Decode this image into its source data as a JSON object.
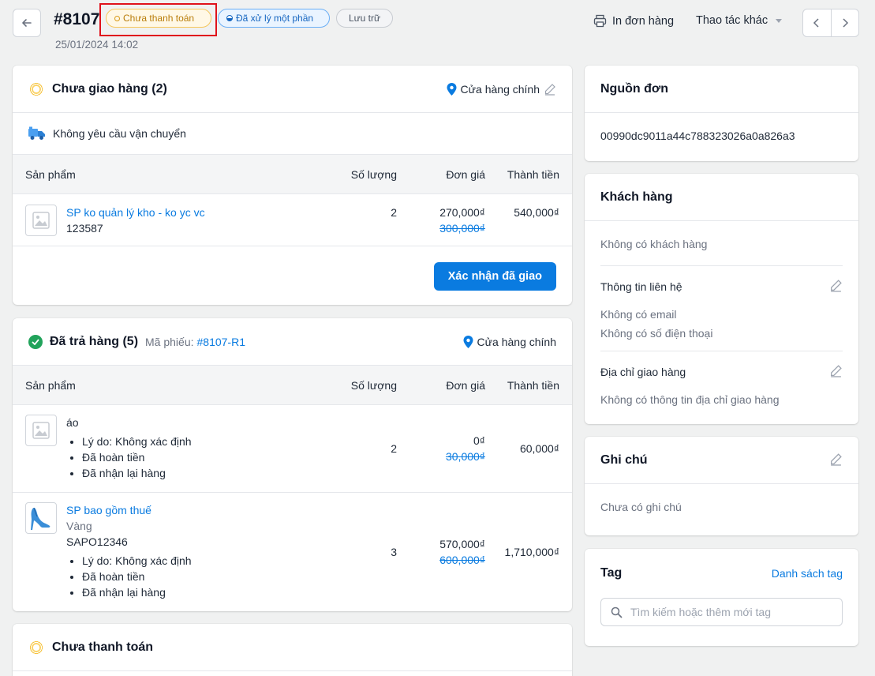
{
  "header": {
    "order_no": "#8107",
    "date": "25/01/2024 14:02",
    "badges": {
      "unpaid": "Chưa thanh toán",
      "partial": "Đã xử lý một phần",
      "archive": "Lưu trữ"
    },
    "print_label": "In đơn hàng",
    "more_label": "Thao tác khác"
  },
  "unfulfilled": {
    "title": "Chưa giao hàng (2)",
    "location": "Cửa hàng chính",
    "shipping_note": "Không yêu cầu vận chuyển",
    "columns": [
      "Sản phẩm",
      "Số lượng",
      "Đơn giá",
      "Thành tiền"
    ],
    "items": [
      {
        "name": "SP ko quản lý kho - ko yc vc",
        "sku": "123587",
        "qty": "2",
        "price": "270,000₫",
        "old_price": "300,000₫",
        "total": "540,000₫"
      }
    ],
    "confirm_button": "Xác nhận đã giao"
  },
  "returned": {
    "title": "Đã trả hàng (5)",
    "ticket_label": "Mã phiếu:",
    "ticket_no": "#8107-R1",
    "location": "Cửa hàng chính",
    "columns": [
      "Sản phẩm",
      "Số lượng",
      "Đơn giá",
      "Thành tiền"
    ],
    "items": [
      {
        "name": "áo",
        "notes": [
          "Lý do: Không xác định",
          "Đã hoàn tiền",
          "Đã nhận lại hàng"
        ],
        "qty": "2",
        "price": "0₫",
        "old_price": "30,000₫",
        "total": "60,000₫"
      },
      {
        "name": "SP bao gồm thuế",
        "variant": "Vàng",
        "sku": "SAPO12346",
        "notes": [
          "Lý do: Không xác định",
          "Đã hoàn tiền",
          "Đã nhận lại hàng"
        ],
        "qty": "3",
        "price": "570,000₫",
        "old_price": "600,000₫",
        "total": "1,710,000₫"
      }
    ]
  },
  "payment": {
    "title": "Chưa thanh toán"
  },
  "source": {
    "title": "Nguồn đơn",
    "value": "00990dc9011a44c788323026a0a826a3"
  },
  "customer": {
    "title": "Khách hàng",
    "none": "Không có khách hàng",
    "contact_title": "Thông tin liên hệ",
    "no_email": "Không có email",
    "no_phone": "Không có số điện thoại",
    "address_title": "Địa chỉ giao hàng",
    "no_address": "Không có thông tin địa chỉ giao hàng"
  },
  "note": {
    "title": "Ghi chú",
    "empty": "Chưa có ghi chú"
  },
  "tag": {
    "title": "Tag",
    "list_link": "Danh sách tag",
    "search_placeholder": "Tìm kiếm hoặc thêm mới tag"
  },
  "colors": {
    "accent": "#0a7be0",
    "warning": "#f5c75c",
    "success": "#21a35b",
    "highlight": "#e0121c"
  }
}
